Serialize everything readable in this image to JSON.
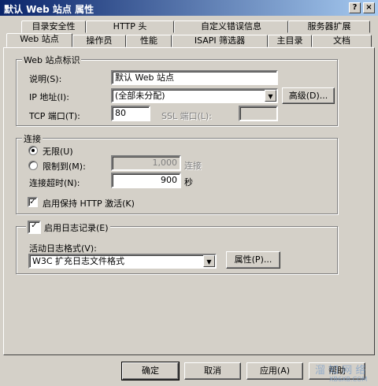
{
  "window": {
    "title": "默认 Web 站点 属性",
    "help_button": "?",
    "close_button": "×"
  },
  "tabs_row1": [
    "目录安全性",
    "HTTP 头",
    "自定义错误信息",
    "服务器扩展"
  ],
  "tabs_row2": [
    "Web 站点",
    "操作员",
    "性能",
    "ISAPI 筛选器",
    "主目录",
    "文档"
  ],
  "identification": {
    "group_label": "Web 站点标识",
    "description_label": "说明(S):",
    "description_value": "默认 Web 站点",
    "ip_label": "IP 地址(I):",
    "ip_value": "(全部未分配)",
    "advanced_button": "高级(D)...",
    "tcp_label": "TCP 端口(T):",
    "tcp_value": "80",
    "ssl_label": "SSL 端口(L):",
    "ssl_value": ""
  },
  "connections": {
    "group_label": "连接",
    "unlimited_label": "无限(U)",
    "limited_label": "限制到(M):",
    "limit_value": "1,000",
    "limit_unit": "连接",
    "timeout_label": "连接超时(N):",
    "timeout_value": "900",
    "timeout_unit": "秒",
    "keepalive_label": "启用保持 HTTP 激活(K)",
    "keepalive_checked": true,
    "unlimited_selected": true
  },
  "logging": {
    "enable_label": "启用日志记录(E)",
    "enable_checked": true,
    "format_label": "活动日志格式(V):",
    "format_value": "W3C 扩充日志文件格式",
    "properties_button": "属性(P)..."
  },
  "footer": {
    "ok": "确定",
    "cancel": "取消",
    "apply": "应用(A)",
    "help": "帮助"
  },
  "watermark": {
    "text": "溜 知 网 络",
    "sub": "XB6XB.COM"
  }
}
